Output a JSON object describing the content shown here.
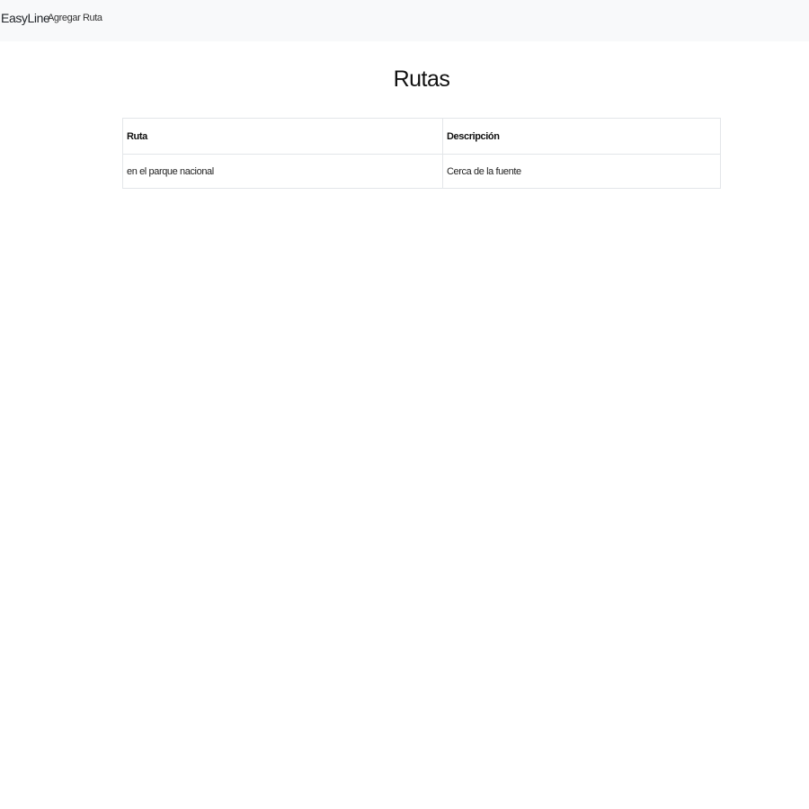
{
  "navbar": {
    "brand": "EasyLine",
    "links": [
      {
        "label": "Agregar Ruta"
      }
    ]
  },
  "page": {
    "title": "Rutas"
  },
  "table": {
    "headers": [
      "Ruta",
      "Descripción"
    ],
    "rows": [
      [
        "en el parque nacional",
        "Cerca de la fuente"
      ]
    ]
  }
}
